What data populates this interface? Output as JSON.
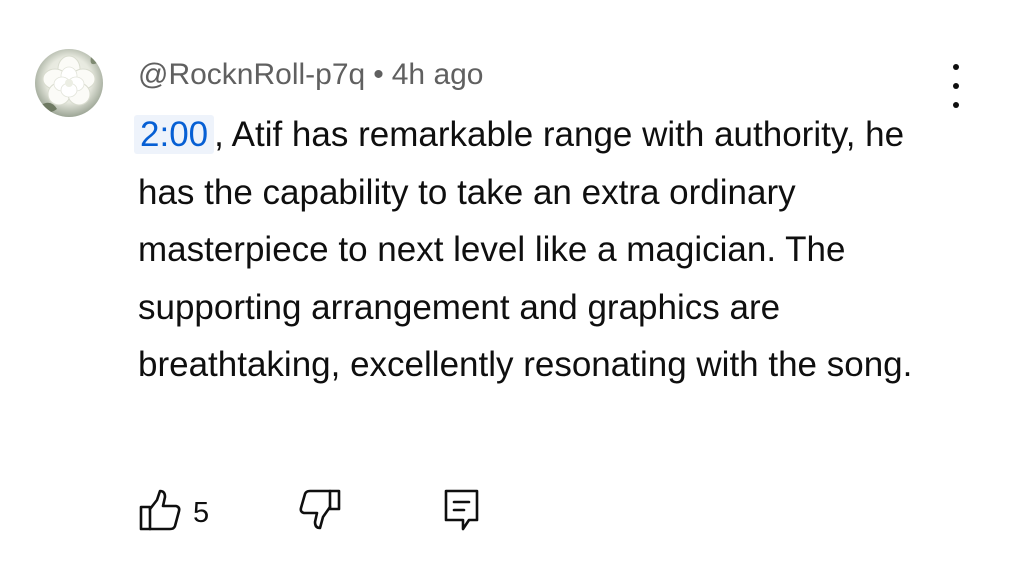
{
  "comment": {
    "author": "@RocknRoll-p7q",
    "separator": "•",
    "time": "4h ago",
    "timestamp_link": "2:00",
    "text": ", Atif has remarkable range with authority, he has the capability to take an extra ordinary masterpiece to next level like a magician. The supporting arrangement and graphics are breathtaking, excellently resonating with the song.",
    "like_count": "5"
  },
  "icons": {
    "avatar": "white-flower-avatar",
    "menu": "more-vertical-icon",
    "like": "thumbs-up-icon",
    "dislike": "thumbs-down-icon",
    "reply": "comment-reply-icon"
  },
  "colors": {
    "timestamp_text": "#065fd4",
    "timestamp_bg": "#eef3fb",
    "meta_text": "#606060",
    "body_text": "#0f0f0f"
  }
}
